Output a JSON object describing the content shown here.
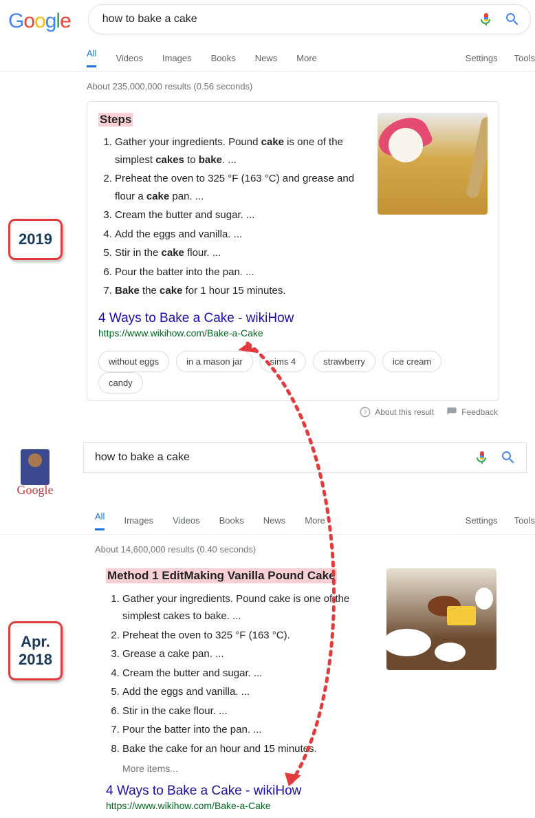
{
  "badges": {
    "y1": "2019",
    "y2": "Apr.\n2018"
  },
  "s2019": {
    "query": "how to bake a cake",
    "tabs": [
      "All",
      "Videos",
      "Images",
      "Books",
      "News",
      "More"
    ],
    "right": [
      "Settings",
      "Tools"
    ],
    "stats": "About 235,000,000 results (0.56 seconds)",
    "heading": "Steps",
    "steps": [
      "Gather your ingredients. Pound <b>cake</b> is one of the simplest <b>cakes</b> to <b>bake</b>. ...",
      "Preheat the oven to 325 °F (163 °C) and grease and flour a <b>cake</b> pan. ...",
      "Cream the butter and sugar. ...",
      "Add the eggs and vanilla. ...",
      "Stir in the <b>cake</b> flour. ...",
      "Pour the batter into the pan. ...",
      "<b>Bake</b> the <b>cake</b> for 1 hour 15 minutes."
    ],
    "link": "4 Ways to Bake a Cake - wikiHow",
    "url": "https://www.wikihow.com/Bake-a-Cake",
    "chips": [
      "without eggs",
      "in a mason jar",
      "sims 4",
      "strawberry",
      "ice cream",
      "candy"
    ],
    "about": "About this result",
    "feedback": "Feedback"
  },
  "s2018": {
    "doodle": "Google",
    "query": "how to bake a cake",
    "tabs": [
      "All",
      "Images",
      "Videos",
      "Books",
      "News",
      "More"
    ],
    "right": [
      "Settings",
      "Tools"
    ],
    "stats": "About 14,600,000 results (0.40 seconds)",
    "heading": "Method 1 EditMaking Vanilla Pound Cake",
    "steps": [
      "Gather your ingredients. Pound cake is one of the simplest cakes to bake. ...",
      "Preheat the oven to 325 °F (163 °C).",
      "Grease a cake pan. ...",
      "Cream the butter and sugar. ...",
      "Add the eggs and vanilla. ...",
      "Stir in the cake flour. ...",
      "Pour the batter into the pan. ...",
      "Bake the cake for an hour and 15 minutes."
    ],
    "more": "More items...",
    "link": "4 Ways to Bake a Cake - wikiHow",
    "url": "https://www.wikihow.com/Bake-a-Cake"
  }
}
